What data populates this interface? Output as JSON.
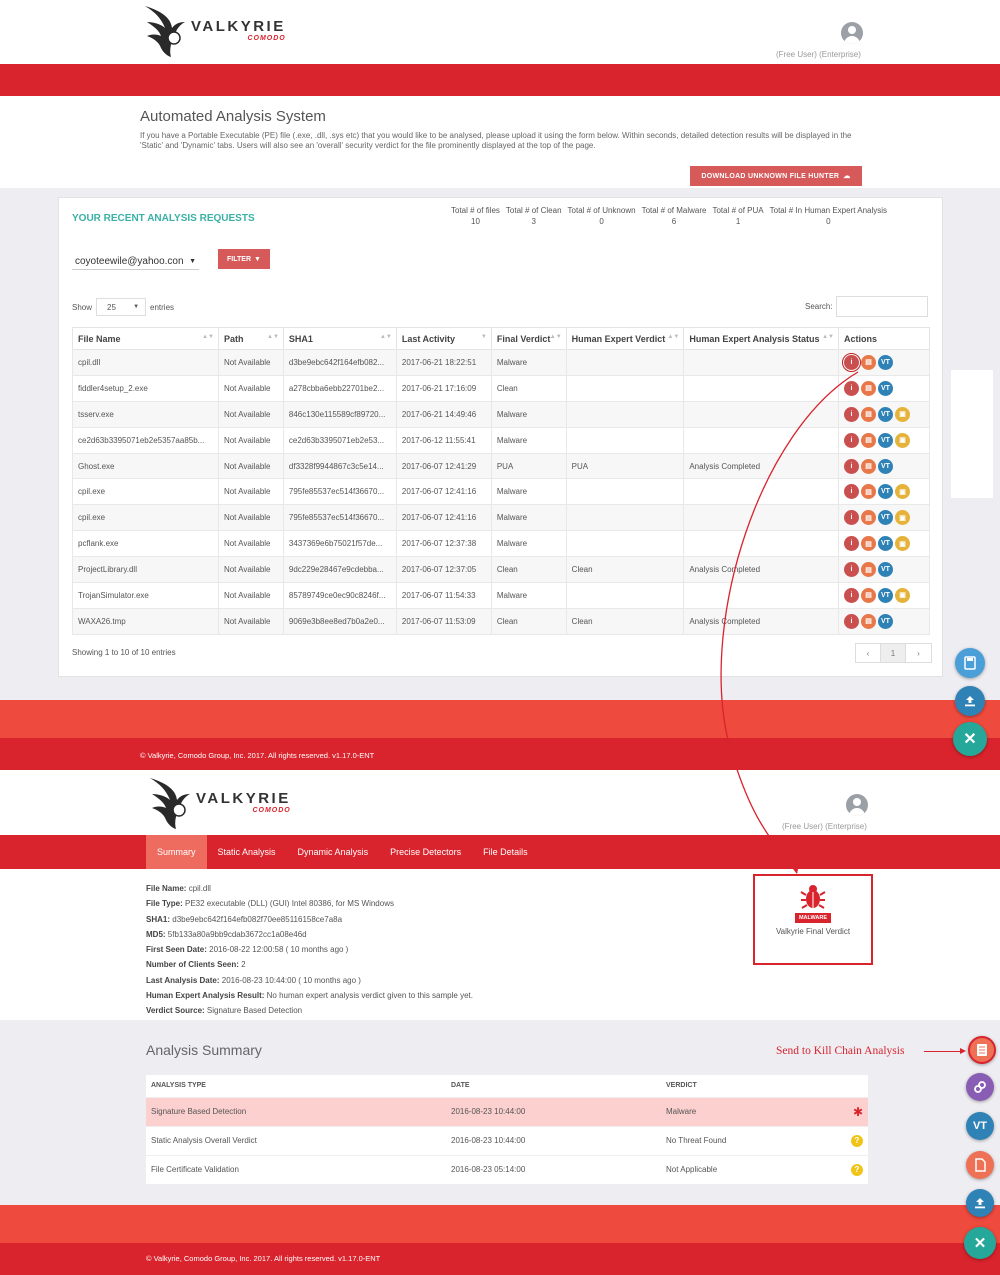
{
  "colors": {
    "brand_red": "#d9232d",
    "teal": "#3ab0a5",
    "action_red": "#d65a5a"
  },
  "top": {
    "logo": {
      "word": "VALKYRIE",
      "sub": "COMODO"
    },
    "user_role": "(Free User) (Enterprise)",
    "page_title": "Automated Analysis System",
    "intro": "If you have a Portable Executable (PE) file (.exe, .dll, .sys etc) that you would like to be analysed, please upload it using the form below. Within seconds, detailed detection results will be displayed in the 'Static' and 'Dynamic' tabs. Users will also see an 'overall' security verdict for the file prominently displayed at the top of the page.",
    "download_btn": "DOWNLOAD UNKNOWN FILE HUNTER",
    "panel_title": "YOUR RECENT ANALYSIS REQUESTS",
    "totals": [
      {
        "label": "Total # of files",
        "value": "10"
      },
      {
        "label": "Total # of Clean",
        "value": "3"
      },
      {
        "label": "Total # of Unknown",
        "value": "0"
      },
      {
        "label": "Total # of Malware",
        "value": "6"
      },
      {
        "label": "Total # of PUA",
        "value": "1"
      },
      {
        "label": "Total # In Human Expert Analysis",
        "value": "0"
      }
    ],
    "email": "coyoteewile@yahoo.con",
    "filter_btn": "FILTER",
    "show_label": "Show",
    "entries_value": "25",
    "entries_label": "entries",
    "search_label": "Search:",
    "columns": [
      "File Name",
      "Path",
      "SHA1",
      "Last Activity",
      "Final Verdict",
      "Human Expert Verdict",
      "Human Expert Analysis Status",
      "Actions"
    ],
    "rows": [
      {
        "file": "cpil.dll",
        "path": "Not Available",
        "sha1": "d3be9ebc642f164efb082...",
        "activity": "2017-06-21 18:22:51",
        "verdict": "Malware",
        "hev": "",
        "status": "",
        "kc": false
      },
      {
        "file": "fiddler4setup_2.exe",
        "path": "Not Available",
        "sha1": "a278cbba6ebb22701be2...",
        "activity": "2017-06-21 17:16:09",
        "verdict": "Clean",
        "hev": "",
        "status": "",
        "kc": false
      },
      {
        "file": "tsserv.exe",
        "path": "Not Available",
        "sha1": "846c130e115589cf89720...",
        "activity": "2017-06-21 14:49:46",
        "verdict": "Malware",
        "hev": "",
        "status": "",
        "kc": true
      },
      {
        "file": "ce2d63b3395071eb2e5357aa85b...",
        "path": "Not Available",
        "sha1": "ce2d63b3395071eb2e53...",
        "activity": "2017-06-12 11:55:41",
        "verdict": "Malware",
        "hev": "",
        "status": "",
        "kc": true
      },
      {
        "file": "Ghost.exe",
        "path": "Not Available",
        "sha1": "df3328f9944867c3c5e14...",
        "activity": "2017-06-07 12:41:29",
        "verdict": "PUA",
        "hev": "PUA",
        "status": "Analysis Completed",
        "kc": false
      },
      {
        "file": "cpil.exe",
        "path": "Not Available",
        "sha1": "795fe85537ec514f36670...",
        "activity": "2017-06-07 12:41:16",
        "verdict": "Malware",
        "hev": "",
        "status": "",
        "kc": true
      },
      {
        "file": "cpil.exe",
        "path": "Not Available",
        "sha1": "795fe85537ec514f36670...",
        "activity": "2017-06-07 12:41:16",
        "verdict": "Malware",
        "hev": "",
        "status": "",
        "kc": true
      },
      {
        "file": "pcflank.exe",
        "path": "Not Available",
        "sha1": "3437369e6b75021f57de...",
        "activity": "2017-06-07 12:37:38",
        "verdict": "Malware",
        "hev": "",
        "status": "",
        "kc": true
      },
      {
        "file": "ProjectLibrary.dll",
        "path": "Not Available",
        "sha1": "9dc229e28467e9cdebba...",
        "activity": "2017-06-07 12:37:05",
        "verdict": "Clean",
        "hev": "Clean",
        "status": "Analysis Completed",
        "kc": false
      },
      {
        "file": "TrojanSimulator.exe",
        "path": "Not Available",
        "sha1": "85789749ce0ec90c8246f...",
        "activity": "2017-06-07 11:54:33",
        "verdict": "Malware",
        "hev": "",
        "status": "",
        "kc": true
      },
      {
        "file": "WAXA26.tmp",
        "path": "Not Available",
        "sha1": "9069e3b8ee8ed7b0a2e0...",
        "activity": "2017-06-07 11:53:09",
        "verdict": "Clean",
        "hev": "Clean",
        "status": "Analysis Completed",
        "kc": false
      }
    ],
    "showing": "Showing 1 to 10 of 10 entries",
    "pager": {
      "prev": "‹",
      "page": "1",
      "next": "›"
    },
    "footer": "© Valkyrie, Comodo Group, Inc. 2017. All rights reserved. v1.17.0-ENT"
  },
  "bottom": {
    "user_role": "(Free User) (Enterprise)",
    "tabs": [
      "Summary",
      "Static Analysis",
      "Dynamic Analysis",
      "Precise Detectors",
      "File Details"
    ],
    "details": [
      {
        "k": "File Name:",
        "v": "cpil.dll"
      },
      {
        "k": "File Type:",
        "v": "PE32 executable (DLL) (GUI) Intel 80386, for MS Windows"
      },
      {
        "k": "SHA1:",
        "v": "d3be9ebc642f164efb082f70ee85116158ce7a8a"
      },
      {
        "k": "MD5:",
        "v": "5fb133a80a9bb9cdab3672cc1a08e46d"
      },
      {
        "k": "First Seen Date:",
        "v": "2016-08-22 12:00:58 ( 10 months ago )"
      },
      {
        "k": "Number of Clients Seen:",
        "v": "2"
      },
      {
        "k": "Last Analysis Date:",
        "v": "2016-08-23 10:44:00 ( 10 months ago )"
      },
      {
        "k": "Human Expert Analysis Result:",
        "v": "No human expert analysis verdict given to this sample yet."
      },
      {
        "k": "Verdict Source:",
        "v": "Signature Based Detection"
      }
    ],
    "verdict_badge": "MALWARE",
    "verdict_label": "Valkyrie Final Verdict",
    "summary_title": "Analysis Summary",
    "kill_chain": "Send to Kill Chain Analysis",
    "summary_columns": [
      "ANALYSIS TYPE",
      "DATE",
      "VERDICT"
    ],
    "summary_rows": [
      {
        "type": "Signature Based Detection",
        "date": "2016-08-23 10:44:00",
        "verdict": "Malware",
        "icon": "bug-icon"
      },
      {
        "type": "Static Analysis Overall Verdict",
        "date": "2016-08-23 10:44:00",
        "verdict": "No Threat Found",
        "icon": "question-icon"
      },
      {
        "type": "File Certificate Validation",
        "date": "2016-08-23 05:14:00",
        "verdict": "Not Applicable",
        "icon": "question-icon"
      }
    ],
    "footer": "© Valkyrie, Comodo Group, Inc. 2017. All rights reserved. v1.17.0-ENT"
  }
}
